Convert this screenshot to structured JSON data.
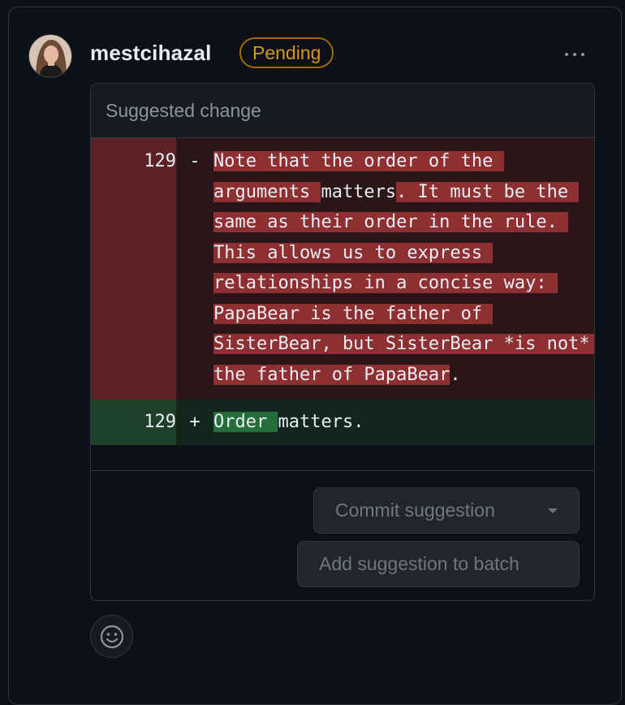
{
  "review": {
    "username": "mestcihazal",
    "status_badge": "Pending"
  },
  "suggestion": {
    "header": "Suggested change",
    "deleted_line_number": "129",
    "added_line_number": "129",
    "deleted_marker": "-",
    "added_marker": "+",
    "deleted_segments": [
      {
        "text": "Note that the order of the arguments ",
        "hl": true
      },
      {
        "text": "matters",
        "hl": false
      },
      {
        "text": ". It must be the same as their order in the rule. This allows us to express relationships in a concise way: PapaBear is the father of SisterBear, but SisterBear *is not* the father of PapaBear",
        "hl": true
      },
      {
        "text": ".",
        "hl": false
      }
    ],
    "added_segments": [
      {
        "text": "Order ",
        "hl": true
      },
      {
        "text": "matters.",
        "hl": false
      }
    ]
  },
  "actions": {
    "commit_label": "Commit suggestion",
    "batch_label": "Add suggestion to batch"
  },
  "icons": {
    "avatar": "user-avatar",
    "more": "kebab-horizontal-icon",
    "caret": "triangle-down-icon",
    "emoji": "smiley-icon"
  },
  "colors": {
    "pending": "#d29922",
    "deleted_highlight": "#8e2f31",
    "added_highlight": "#256e3a"
  }
}
